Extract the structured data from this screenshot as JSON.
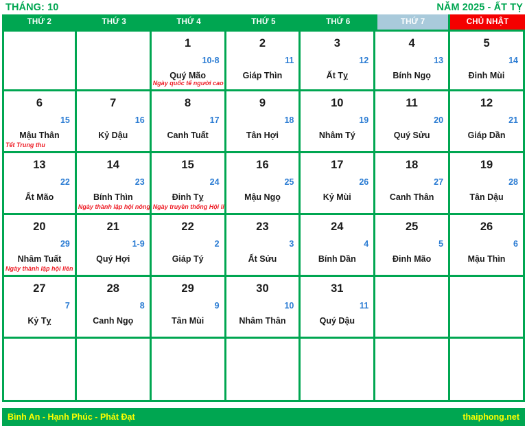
{
  "header": {
    "month_label": "THÁNG: 10",
    "year_label": "NĂM 2025 - ẤT TỴ"
  },
  "weekdays": [
    {
      "label": "THỨ 2",
      "kind": "weekday"
    },
    {
      "label": "THỨ 3",
      "kind": "weekday"
    },
    {
      "label": "THỨ 4",
      "kind": "weekday"
    },
    {
      "label": "THỨ 5",
      "kind": "weekday"
    },
    {
      "label": "THỨ 6",
      "kind": "weekday"
    },
    {
      "label": "THỨ 7",
      "kind": "saturday"
    },
    {
      "label": "CHỦ NHẬT",
      "kind": "sunday"
    }
  ],
  "colors": {
    "green": "#00a651",
    "red": "#f40000",
    "saturday_blue": "#a9cadb",
    "lunar_blue": "#2b7cd3",
    "event_red": "#ee1c25",
    "footer_yellow": "#ffff00"
  },
  "weeks": [
    [
      {
        "solar": "",
        "lunar": "",
        "canchi": "",
        "event": ""
      },
      {
        "solar": "",
        "lunar": "",
        "canchi": "",
        "event": ""
      },
      {
        "solar": "1",
        "lunar": "10-8",
        "canchi": "Quý Mão",
        "event": "Ngày quốc tế người cao tuổi"
      },
      {
        "solar": "2",
        "lunar": "11",
        "canchi": "Giáp Thìn",
        "event": ""
      },
      {
        "solar": "3",
        "lunar": "12",
        "canchi": "Ất Tỵ",
        "event": ""
      },
      {
        "solar": "4",
        "lunar": "13",
        "canchi": "Bính Ngọ",
        "event": ""
      },
      {
        "solar": "5",
        "lunar": "14",
        "canchi": "Đinh Mùi",
        "event": ""
      }
    ],
    [
      {
        "solar": "6",
        "lunar": "15",
        "canchi": "Mậu Thân",
        "event": "Tết Trung thu"
      },
      {
        "solar": "7",
        "lunar": "16",
        "canchi": "Kỷ Dậu",
        "event": ""
      },
      {
        "solar": "8",
        "lunar": "17",
        "canchi": "Canh Tuất",
        "event": ""
      },
      {
        "solar": "9",
        "lunar": "18",
        "canchi": "Tân Hợi",
        "event": ""
      },
      {
        "solar": "10",
        "lunar": "19",
        "canchi": "Nhâm Tý",
        "event": ""
      },
      {
        "solar": "11",
        "lunar": "20",
        "canchi": "Quý Sửu",
        "event": ""
      },
      {
        "solar": "12",
        "lunar": "21",
        "canchi": "Giáp Dần",
        "event": ""
      }
    ],
    [
      {
        "solar": "13",
        "lunar": "22",
        "canchi": "Ất Mão",
        "event": ""
      },
      {
        "solar": "14",
        "lunar": "23",
        "canchi": "Bính Thìn",
        "event": "Ngày thành lập hội nông dân VN"
      },
      {
        "solar": "15",
        "lunar": "24",
        "canchi": "Đinh Tỵ",
        "event": "Ngày truyền thống Hội liên hiệp thanh niên VN"
      },
      {
        "solar": "16",
        "lunar": "25",
        "canchi": "Mậu Ngọ",
        "event": ""
      },
      {
        "solar": "17",
        "lunar": "26",
        "canchi": "Kỷ Mùi",
        "event": ""
      },
      {
        "solar": "18",
        "lunar": "27",
        "canchi": "Canh Thân",
        "event": ""
      },
      {
        "solar": "19",
        "lunar": "28",
        "canchi": "Tân Dậu",
        "event": ""
      }
    ],
    [
      {
        "solar": "20",
        "lunar": "29",
        "canchi": "Nhâm Tuất",
        "event": "Ngày thành lập hội liên hiệp phụ nữ VN"
      },
      {
        "solar": "21",
        "lunar": "1-9",
        "canchi": "Quý Hợi",
        "event": ""
      },
      {
        "solar": "22",
        "lunar": "2",
        "canchi": "Giáp Tý",
        "event": ""
      },
      {
        "solar": "23",
        "lunar": "3",
        "canchi": "Ất Sửu",
        "event": ""
      },
      {
        "solar": "24",
        "lunar": "4",
        "canchi": "Bính Dần",
        "event": ""
      },
      {
        "solar": "25",
        "lunar": "5",
        "canchi": "Đinh Mão",
        "event": ""
      },
      {
        "solar": "26",
        "lunar": "6",
        "canchi": "Mậu Thìn",
        "event": ""
      }
    ],
    [
      {
        "solar": "27",
        "lunar": "7",
        "canchi": "Kỷ Tỵ",
        "event": ""
      },
      {
        "solar": "28",
        "lunar": "8",
        "canchi": "Canh Ngọ",
        "event": ""
      },
      {
        "solar": "29",
        "lunar": "9",
        "canchi": "Tân Mùi",
        "event": ""
      },
      {
        "solar": "30",
        "lunar": "10",
        "canchi": "Nhâm Thân",
        "event": ""
      },
      {
        "solar": "31",
        "lunar": "11",
        "canchi": "Quý Dậu",
        "event": ""
      },
      {
        "solar": "",
        "lunar": "",
        "canchi": "",
        "event": ""
      },
      {
        "solar": "",
        "lunar": "",
        "canchi": "",
        "event": ""
      }
    ],
    [
      {
        "solar": "",
        "lunar": "",
        "canchi": "",
        "event": ""
      },
      {
        "solar": "",
        "lunar": "",
        "canchi": "",
        "event": ""
      },
      {
        "solar": "",
        "lunar": "",
        "canchi": "",
        "event": ""
      },
      {
        "solar": "",
        "lunar": "",
        "canchi": "",
        "event": ""
      },
      {
        "solar": "",
        "lunar": "",
        "canchi": "",
        "event": ""
      },
      {
        "solar": "",
        "lunar": "",
        "canchi": "",
        "event": ""
      },
      {
        "solar": "",
        "lunar": "",
        "canchi": "",
        "event": ""
      }
    ]
  ],
  "footer": {
    "slogan": "Bình An - Hạnh Phúc - Phát Đạt",
    "site": "thaiphong.net"
  }
}
